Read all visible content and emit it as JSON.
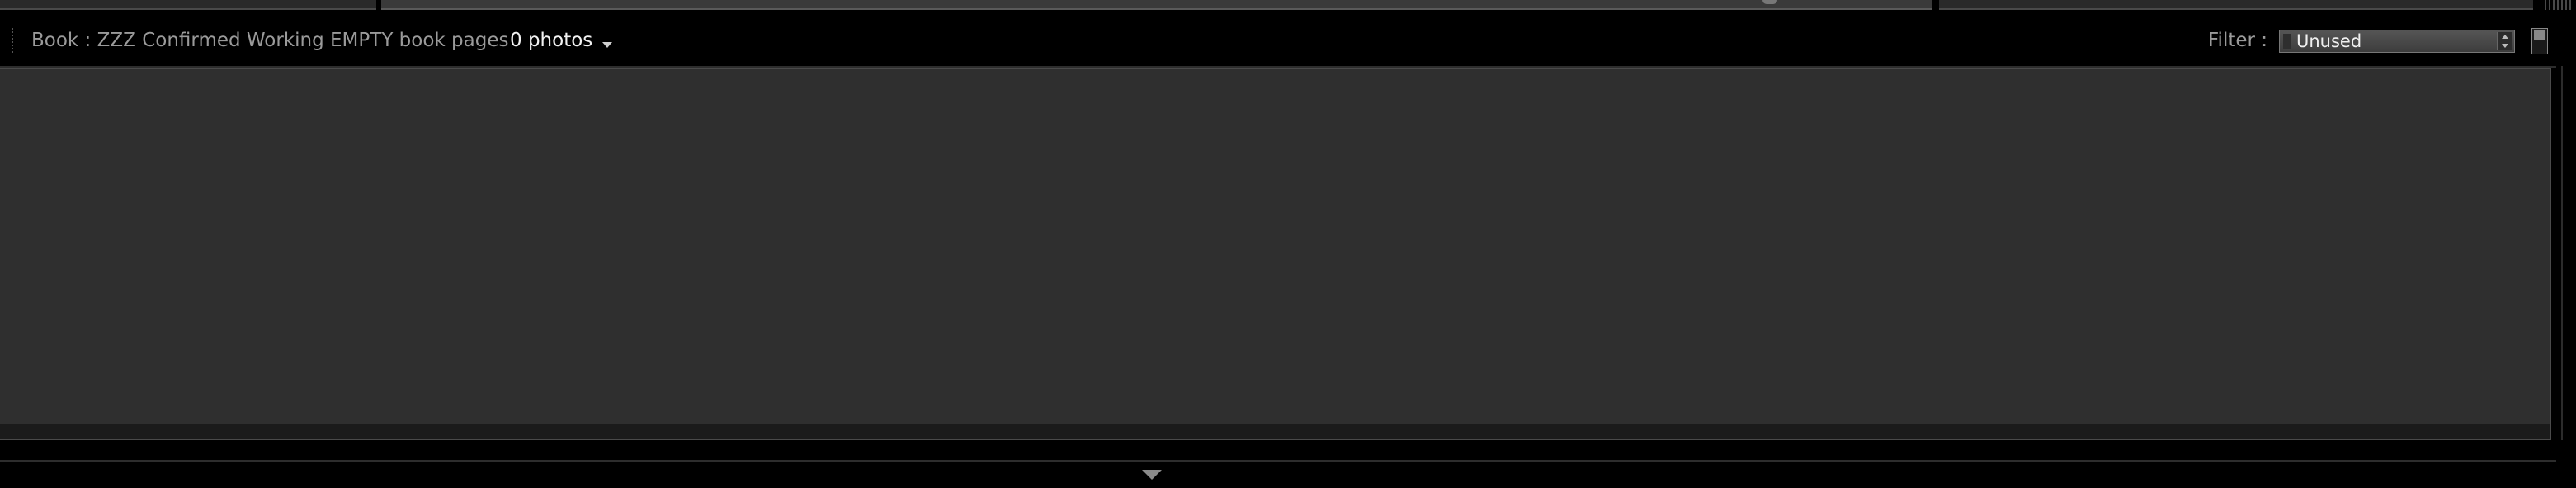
{
  "header": {
    "source_label": "Book : ZZZ Confirmed Working EMPTY book pages",
    "photo_count": "0 photos",
    "filter_label": "Filter :",
    "filter_value": "Unused"
  },
  "icons": {
    "photo_count_dropdown": "chevron-down-icon",
    "filter_stepper": "stepper-icon",
    "filter_lock": "lock-toggle-icon",
    "collapse_panel": "triangle-down-icon"
  },
  "colors": {
    "background": "#000000",
    "filmstrip": "#2f2f2f",
    "label_gray": "#9a9a9a",
    "bright_text": "#f2f2f2"
  }
}
